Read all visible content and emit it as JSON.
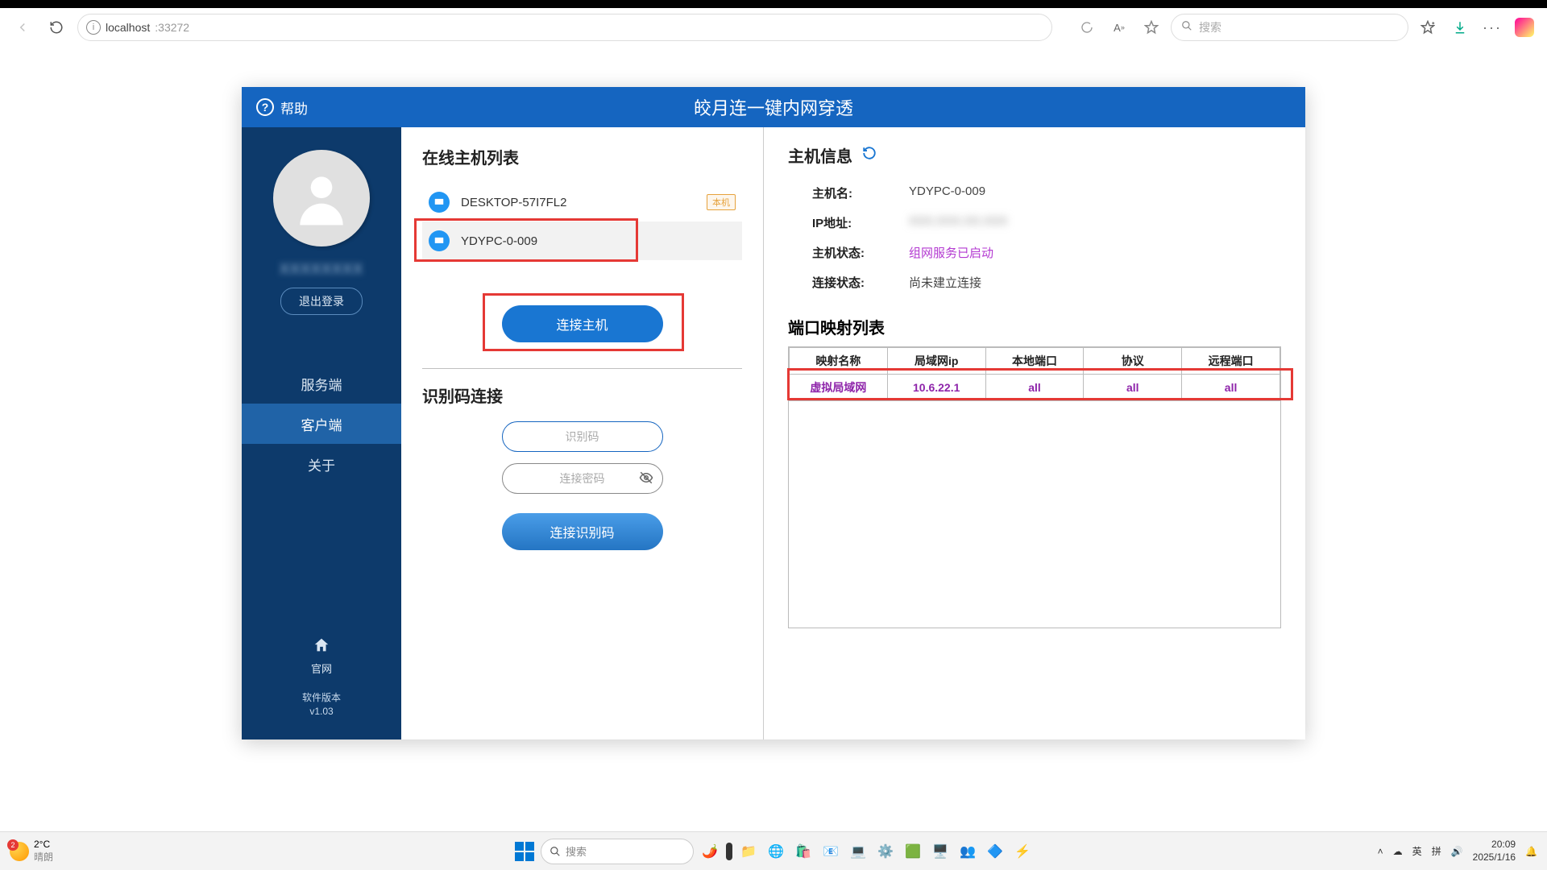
{
  "browser": {
    "url_host": "localhost",
    "url_port": ":33272",
    "search_placeholder": "搜索",
    "read_aloud_char": "A⁺"
  },
  "app": {
    "help": "帮助",
    "title": "皎月连一键内网穿透"
  },
  "sidebar": {
    "username": "XXXXXXXX",
    "logout": "退出登录",
    "nav": {
      "server": "服务端",
      "client": "客户端",
      "about": "关于"
    },
    "home": "官网",
    "version_label": "软件版本",
    "version": "v1.03"
  },
  "hosts": {
    "title": "在线主机列表",
    "items": [
      {
        "name": "DESKTOP-57I7FL2",
        "badge": "本机"
      },
      {
        "name": "YDYPC-0-009",
        "badge": ""
      }
    ],
    "connect_btn": "连接主机"
  },
  "id_connect": {
    "title": "识别码连接",
    "id_placeholder": "识别码",
    "pw_placeholder": "连接密码",
    "btn": "连接识别码"
  },
  "host_info": {
    "title": "主机信息",
    "rows": {
      "name_label": "主机名:",
      "name_value": "YDYPC-0-009",
      "ip_label": "IP地址:",
      "ip_value": "XXX.XXX.XX.XXX",
      "status_label": "主机状态:",
      "status_value": "组网服务已启动",
      "conn_label": "连接状态:",
      "conn_value": "尚未建立连接"
    }
  },
  "port_map": {
    "title": "端口映射列表",
    "headers": {
      "name": "映射名称",
      "lan_ip": "局域网ip",
      "local_port": "本地端口",
      "protocol": "协议",
      "remote_port": "远程端口"
    },
    "rows": [
      {
        "name": "虚拟局域网",
        "lan_ip": "10.6.22.1",
        "local_port": "all",
        "protocol": "all",
        "remote_port": "all"
      }
    ]
  },
  "taskbar": {
    "weather_temp": "2°C",
    "weather_desc": "晴朗",
    "weather_badge": "2",
    "search": "搜索",
    "ime": "英",
    "pinyin": "拼",
    "time": "20:09",
    "date": "2025/1/16"
  }
}
